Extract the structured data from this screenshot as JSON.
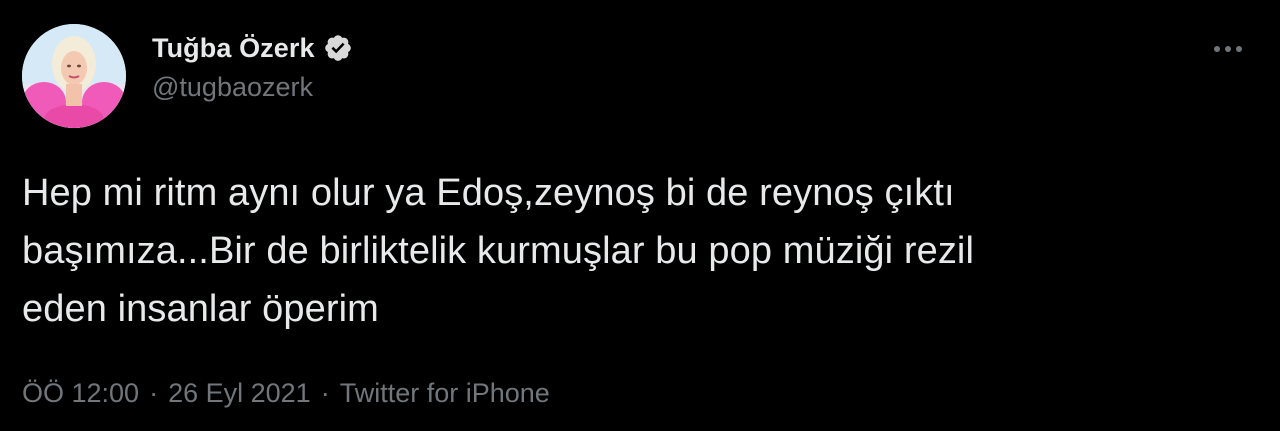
{
  "author": {
    "display_name": "Tuğba Özerk",
    "handle": "@tugbaozerk",
    "verified": true,
    "avatar_icon": "profile-photo"
  },
  "tweet": {
    "text": "Hep mi ritm aynı olur ya Edoş,zeynoş bi de reynoş çıktı\nbaşımıza...Bir de birliktelik kurmuşlar bu pop müziği rezil\neden insanlar öperim"
  },
  "meta": {
    "time": "ÖÖ 12:00",
    "separator": "·",
    "date": "26 Eyl 2021",
    "source": "Twitter for iPhone"
  },
  "icons": {
    "more": "more-horizontal-icon",
    "verified": "verified-badge-icon"
  },
  "colors": {
    "background": "#000000",
    "primary_text": "#e7e9ea",
    "secondary_text": "#71767b",
    "verified_badge": "#d9d9d9"
  }
}
